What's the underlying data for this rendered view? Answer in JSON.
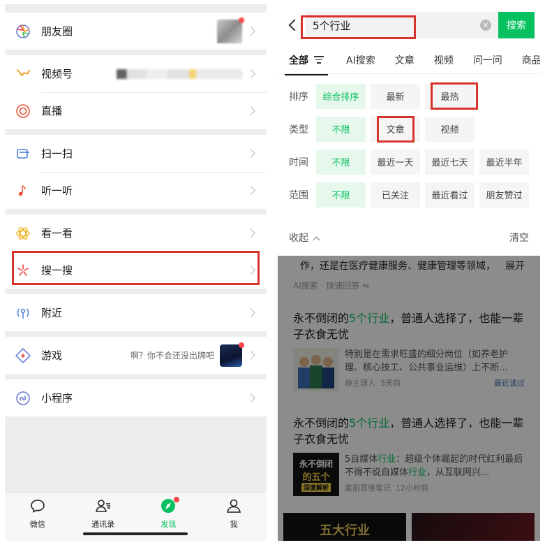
{
  "left_panel": {
    "menu_groups": [
      [
        {
          "label": "朋友圈",
          "icon": "moments-icon"
        }
      ],
      [
        {
          "label": "视频号",
          "icon": "channels-icon"
        },
        {
          "label": "直播",
          "icon": "live-icon"
        }
      ],
      [
        {
          "label": "扫一扫",
          "icon": "scan-icon"
        },
        {
          "label": "听一听",
          "icon": "music-note-icon"
        }
      ],
      [
        {
          "label": "看一看",
          "icon": "top-stories-icon"
        },
        {
          "label": "搜一搜",
          "icon": "search-spark-icon"
        }
      ],
      [
        {
          "label": "附近",
          "icon": "nearby-icon"
        }
      ],
      [
        {
          "label": "游戏",
          "icon": "game-icon",
          "extra": "啊？你不会还没出牌吧"
        }
      ],
      [
        {
          "label": "小程序",
          "icon": "mini-program-icon"
        }
      ]
    ],
    "tabbar": [
      {
        "label": "微信",
        "icon": "chat-bubble-icon"
      },
      {
        "label": "通讯录",
        "icon": "contacts-icon"
      },
      {
        "label": "发现",
        "icon": "discover-compass-icon",
        "active": true
      },
      {
        "label": "我",
        "icon": "me-person-icon"
      }
    ],
    "colors": {
      "accent": "#07c160",
      "highlight": "#d8322d",
      "badge": "#f54545"
    }
  },
  "right_panel": {
    "search": {
      "query": "5个行业",
      "clear_icon": "×",
      "button": "搜索"
    },
    "tabs": [
      "全部",
      "AI搜索",
      "文章",
      "视频",
      "问一问",
      "商品"
    ],
    "filters": [
      {
        "label": "排序",
        "options": [
          "综合排序",
          "最新",
          "最热"
        ],
        "selected": 0
      },
      {
        "label": "类型",
        "options": [
          "不限",
          "文章",
          "视频"
        ],
        "selected": 0
      },
      {
        "label": "时间",
        "options": [
          "不限",
          "最近一天",
          "最近七天",
          "最近半年"
        ],
        "selected": 0
      },
      {
        "label": "范围",
        "options": [
          "不限",
          "已关注",
          "最近看过",
          "朋友赞过"
        ],
        "selected": 0
      }
    ],
    "collapse_label": "收起",
    "clear_label": "清空",
    "result_tail": {
      "text": "作，还是在医疗健康服务、健康管理等领域，",
      "more": "展开"
    },
    "ai_meta": "AI搜索 · 快速回答 ⇋",
    "results": [
      {
        "title_pre": "永不倒闭的",
        "title_kw": "5个行业",
        "title_post": "，普通人选择了，也能一辈子衣食无忧",
        "text": "特别是在需求旺盛的细分岗位（如养老护理、核心技工、公共事业运维）上不断...",
        "source": "峥主理人",
        "time": "3天前",
        "tag": "最近读过"
      },
      {
        "title_pre": "永不倒闭的",
        "title_kw": "5个行业",
        "title_post": "，普通人选择了，也能一辈子衣食无忧",
        "text_pre": "5自媒体",
        "text_kw": "行业",
        "text_mid": "：超级个体崛起的时代红利最后不得不说自媒体",
        "text_kw2": "行业",
        "text_post": "，从互联网兴...",
        "source": "富丽思维笔记",
        "time": "12小时前",
        "thumb_lines": [
          "永不倒闭",
          "的五个",
          "深度解析"
        ]
      }
    ],
    "bottom_thumbs": [
      "五大行业",
      ""
    ]
  }
}
